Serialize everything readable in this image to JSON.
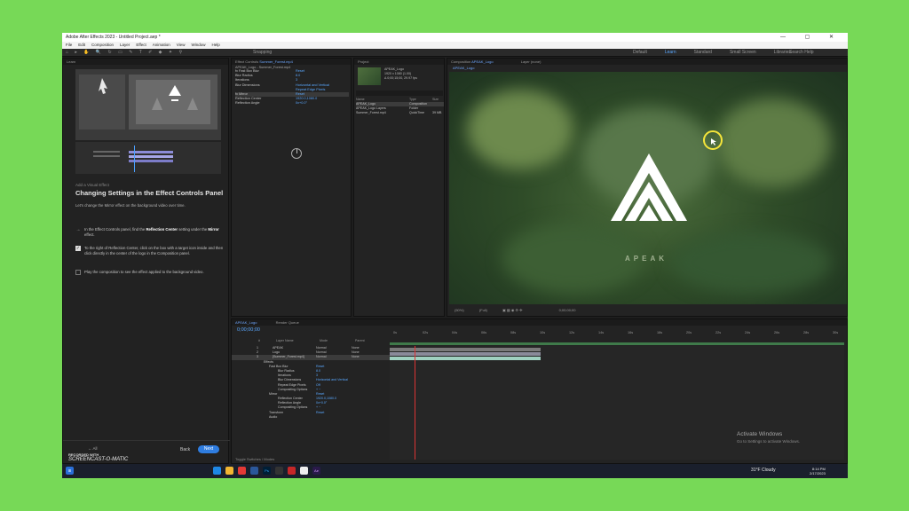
{
  "window": {
    "title": "Adobe After Effects 2023 - Untitled Project.aep *"
  },
  "menu": [
    "File",
    "Edit",
    "Composition",
    "Layer",
    "Effect",
    "Animation",
    "View",
    "Window",
    "Help"
  ],
  "toolbar": {
    "snapping": "Snapping",
    "workspaces": [
      "Default",
      "Learn",
      "Standard",
      "Small Screen",
      "Libraries"
    ],
    "active_workspace": "Learn",
    "search": "Search Help"
  },
  "learn": {
    "tab": "Learn",
    "kicker": "Add a Visual Effect",
    "title": "Changing Settings in the Effect Controls Panel",
    "description": "Let's change the Mirror effect on the background video over time.",
    "steps": [
      {
        "text_pre": "In the Effect Controls panel, find the ",
        "bold1": "Reflection Center",
        "text_mid": " setting under the ",
        "bold2": "Mirror",
        "text_post": " effect.",
        "state": "current"
      },
      {
        "text": "To the right of Reflection Center, click on the box with a target icon inside and then click directly in the center of the logo in the Composition panel.",
        "state": "checked"
      },
      {
        "text": "Play the composition to see the effect applied to the background video.",
        "state": "unchecked"
      }
    ],
    "all_label": "All",
    "back_label": "Back",
    "next_label": "Next",
    "recorded_with": "RECORDED WITH",
    "brand": "SCREENCAST-O-MATIC"
  },
  "effect_controls": {
    "tab": "Effect Controls",
    "tab_target": "Summer_Forest.mp4",
    "path": "APEAK_Logo - Summer_Forest.mp4",
    "rows": [
      {
        "label": "fx  Fast Box Blur",
        "value": "Reset"
      },
      {
        "label": "     Blur Radius",
        "value": "8.0"
      },
      {
        "label": "     Iterations",
        "value": "3"
      },
      {
        "label": "     Blur Dimensions",
        "value": "Horizontal and Vertical"
      },
      {
        "label": "",
        "value": "Repeat Edge Pixels"
      },
      {
        "label": "fx  Mirror",
        "value": "Reset",
        "selected": true
      },
      {
        "label": "     Reflection Center",
        "value": "1920.0,1080.0"
      },
      {
        "label": "     Reflection Angle",
        "value": "0x+0.0°"
      }
    ]
  },
  "project": {
    "tab": "Project",
    "info": [
      "APEAK_Logo",
      "1920 x 1080 (1.00)",
      "Δ 0;00;15;00, 29.97 fps"
    ],
    "columns": {
      "name": "Name",
      "type": "Type",
      "size": "Size"
    },
    "items": [
      {
        "name": "APEAK_Logo",
        "type": "Composition",
        "size": "",
        "selected": true
      },
      {
        "name": "APEAK_Logo Layers",
        "type": "Folder",
        "size": ""
      },
      {
        "name": "Summer_Forest.mp4",
        "type": "QuickTime",
        "size": "39 MB"
      }
    ]
  },
  "composition": {
    "tab": "Composition",
    "comp_name": "APEAK_Logo",
    "layer_tab": "Layer (none)",
    "crumb": "APEAK_Logo",
    "logo_text": "APEAK",
    "zoom": "(50%)",
    "quality": "(Full)",
    "timecode": "0;00;00;00",
    "colors": {
      "bg_center": "#4b6c3b",
      "logo": "#ffffff",
      "cursor_ring": "#f5e53a"
    }
  },
  "timeline": {
    "tab": "APEAK_Logo",
    "render_queue": "Render Queue",
    "timecode": "0;00;00;00",
    "columns": [
      "#",
      "Layer Name",
      "Mode",
      "Parent"
    ],
    "layers": [
      {
        "num": "1",
        "name": "APEAK",
        "mode": "Normal",
        "parent": "None"
      },
      {
        "num": "2",
        "name": "Logo",
        "mode": "Normal",
        "parent": "None"
      },
      {
        "num": "3",
        "name": "[Summer_Forest.mp4]",
        "mode": "Normal",
        "parent": "None",
        "selected": true
      }
    ],
    "props": [
      {
        "label": "Effects",
        "value": ""
      },
      {
        "label": "Fast Box Blur",
        "value": "Reset"
      },
      {
        "label": "Blur Radius",
        "value": "8.0"
      },
      {
        "label": "Iterations",
        "value": "3"
      },
      {
        "label": "Blur Dimensions",
        "value": "Horizontal and Vertical"
      },
      {
        "label": "Repeat Edge Pixels",
        "value": "Off"
      },
      {
        "label": "Compositing Options",
        "value": "+ −"
      },
      {
        "label": "Mirror",
        "value": "Reset"
      },
      {
        "label": "Reflection Center",
        "value": "1920.0,1080.0"
      },
      {
        "label": "Reflection Angle",
        "value": "0x+0.0°"
      },
      {
        "label": "Compositing Options",
        "value": "+ −"
      },
      {
        "label": "Transform",
        "value": "Reset"
      },
      {
        "label": "Audio",
        "value": ""
      }
    ],
    "ruler": [
      "0s",
      "02s",
      "04s",
      "06s",
      "08s",
      "10s",
      "12s",
      "14s",
      "16s",
      "18s",
      "20s",
      "22s",
      "24s",
      "26s",
      "28s",
      "30s"
    ],
    "footer": "Toggle Switches / Modes"
  },
  "watermark": {
    "title": "Activate Windows",
    "subtitle": "Go to Settings to activate Windows."
  },
  "taskbar": {
    "weather": "31°F  Cloudy",
    "time": "8:14 PM",
    "date": "2/17/2023"
  }
}
